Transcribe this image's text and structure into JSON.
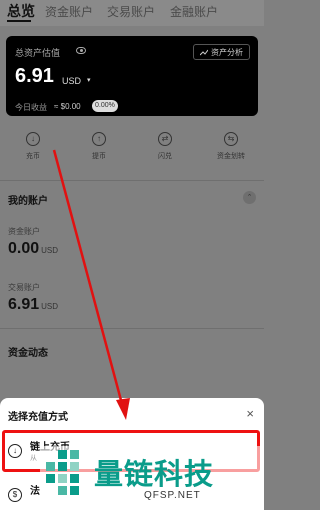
{
  "tabs": [
    {
      "label": "总览",
      "active": true
    },
    {
      "label": "资金账户",
      "active": false
    },
    {
      "label": "交易账户",
      "active": false
    },
    {
      "label": "金融账户",
      "active": false
    }
  ],
  "overview": {
    "label": "总资产估值",
    "analysis_button": "资产分析",
    "total_value": "6.91",
    "currency": "USD",
    "today_label": "今日收益",
    "today_value": "≈ $0.00",
    "today_pct": "0.00%"
  },
  "actions": [
    {
      "label": "充币",
      "icon": "deposit-icon",
      "glyph": "↓"
    },
    {
      "label": "提币",
      "icon": "withdraw-icon",
      "glyph": "↑"
    },
    {
      "label": "闪兑",
      "icon": "swap-icon",
      "glyph": "⇄"
    },
    {
      "label": "资金划转",
      "icon": "transfer-icon",
      "glyph": "⇆"
    }
  ],
  "my_accounts": {
    "title": "我的账户",
    "items": [
      {
        "label": "资金账户",
        "value": "0.00",
        "unit": "USD"
      },
      {
        "label": "交易账户",
        "value": "6.91",
        "unit": "USD"
      }
    ]
  },
  "activity": {
    "title": "资金动态"
  },
  "sheet": {
    "title": "选择充值方式",
    "close_glyph": "×",
    "options": [
      {
        "title": "链上充币",
        "desc": "从",
        "icon": "deposit-icon",
        "glyph": "↓"
      },
      {
        "title": "法",
        "desc": "",
        "icon": "fiat-icon",
        "glyph": "$"
      }
    ]
  },
  "watermark": {
    "name": "量链科技",
    "site": "QFSP.NET"
  },
  "colors": {
    "highlight": "#e11111",
    "watermark_teal": "#0a9c8a",
    "overlay": "#808080"
  }
}
